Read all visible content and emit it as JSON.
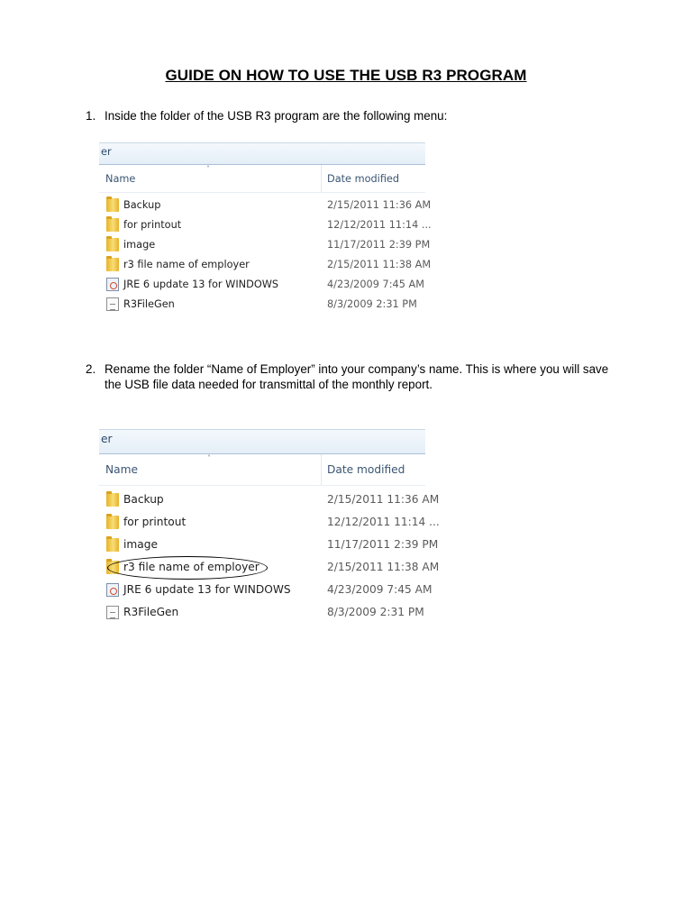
{
  "title": "GUIDE ON HOW TO USE THE USB R3 PROGRAM",
  "steps": [
    {
      "num": "1.",
      "text": "Inside the folder of the USB R3 program are the following menu:"
    },
    {
      "num": "2.",
      "text": "Rename the folder “Name of Employer” into your company’s name. This is where you will save the USB file data needed for transmittal of the monthly report."
    }
  ],
  "explorer": {
    "breadcrumb": "er",
    "col_name": "Name",
    "col_date": "Date modified",
    "sort_glyph": "˄",
    "rows": [
      {
        "icon": "folder-icon",
        "name": "Backup",
        "date": "2/15/2011 11:36 AM"
      },
      {
        "icon": "folder-icon",
        "name": "for printout",
        "date": "12/12/2011 11:14 ..."
      },
      {
        "icon": "folder-icon",
        "name": "image",
        "date": "11/17/2011 2:39 PM"
      },
      {
        "icon": "folder-icon",
        "name": "r3 file name of employer",
        "date": "2/15/2011 11:38 AM"
      },
      {
        "icon": "java-installer-icon",
        "name": "JRE 6 update 13 for WINDOWS",
        "date": "4/23/2009 7:45 AM"
      },
      {
        "icon": "document-icon",
        "name": "R3FileGen",
        "date": "8/3/2009 2:31 PM"
      }
    ]
  }
}
